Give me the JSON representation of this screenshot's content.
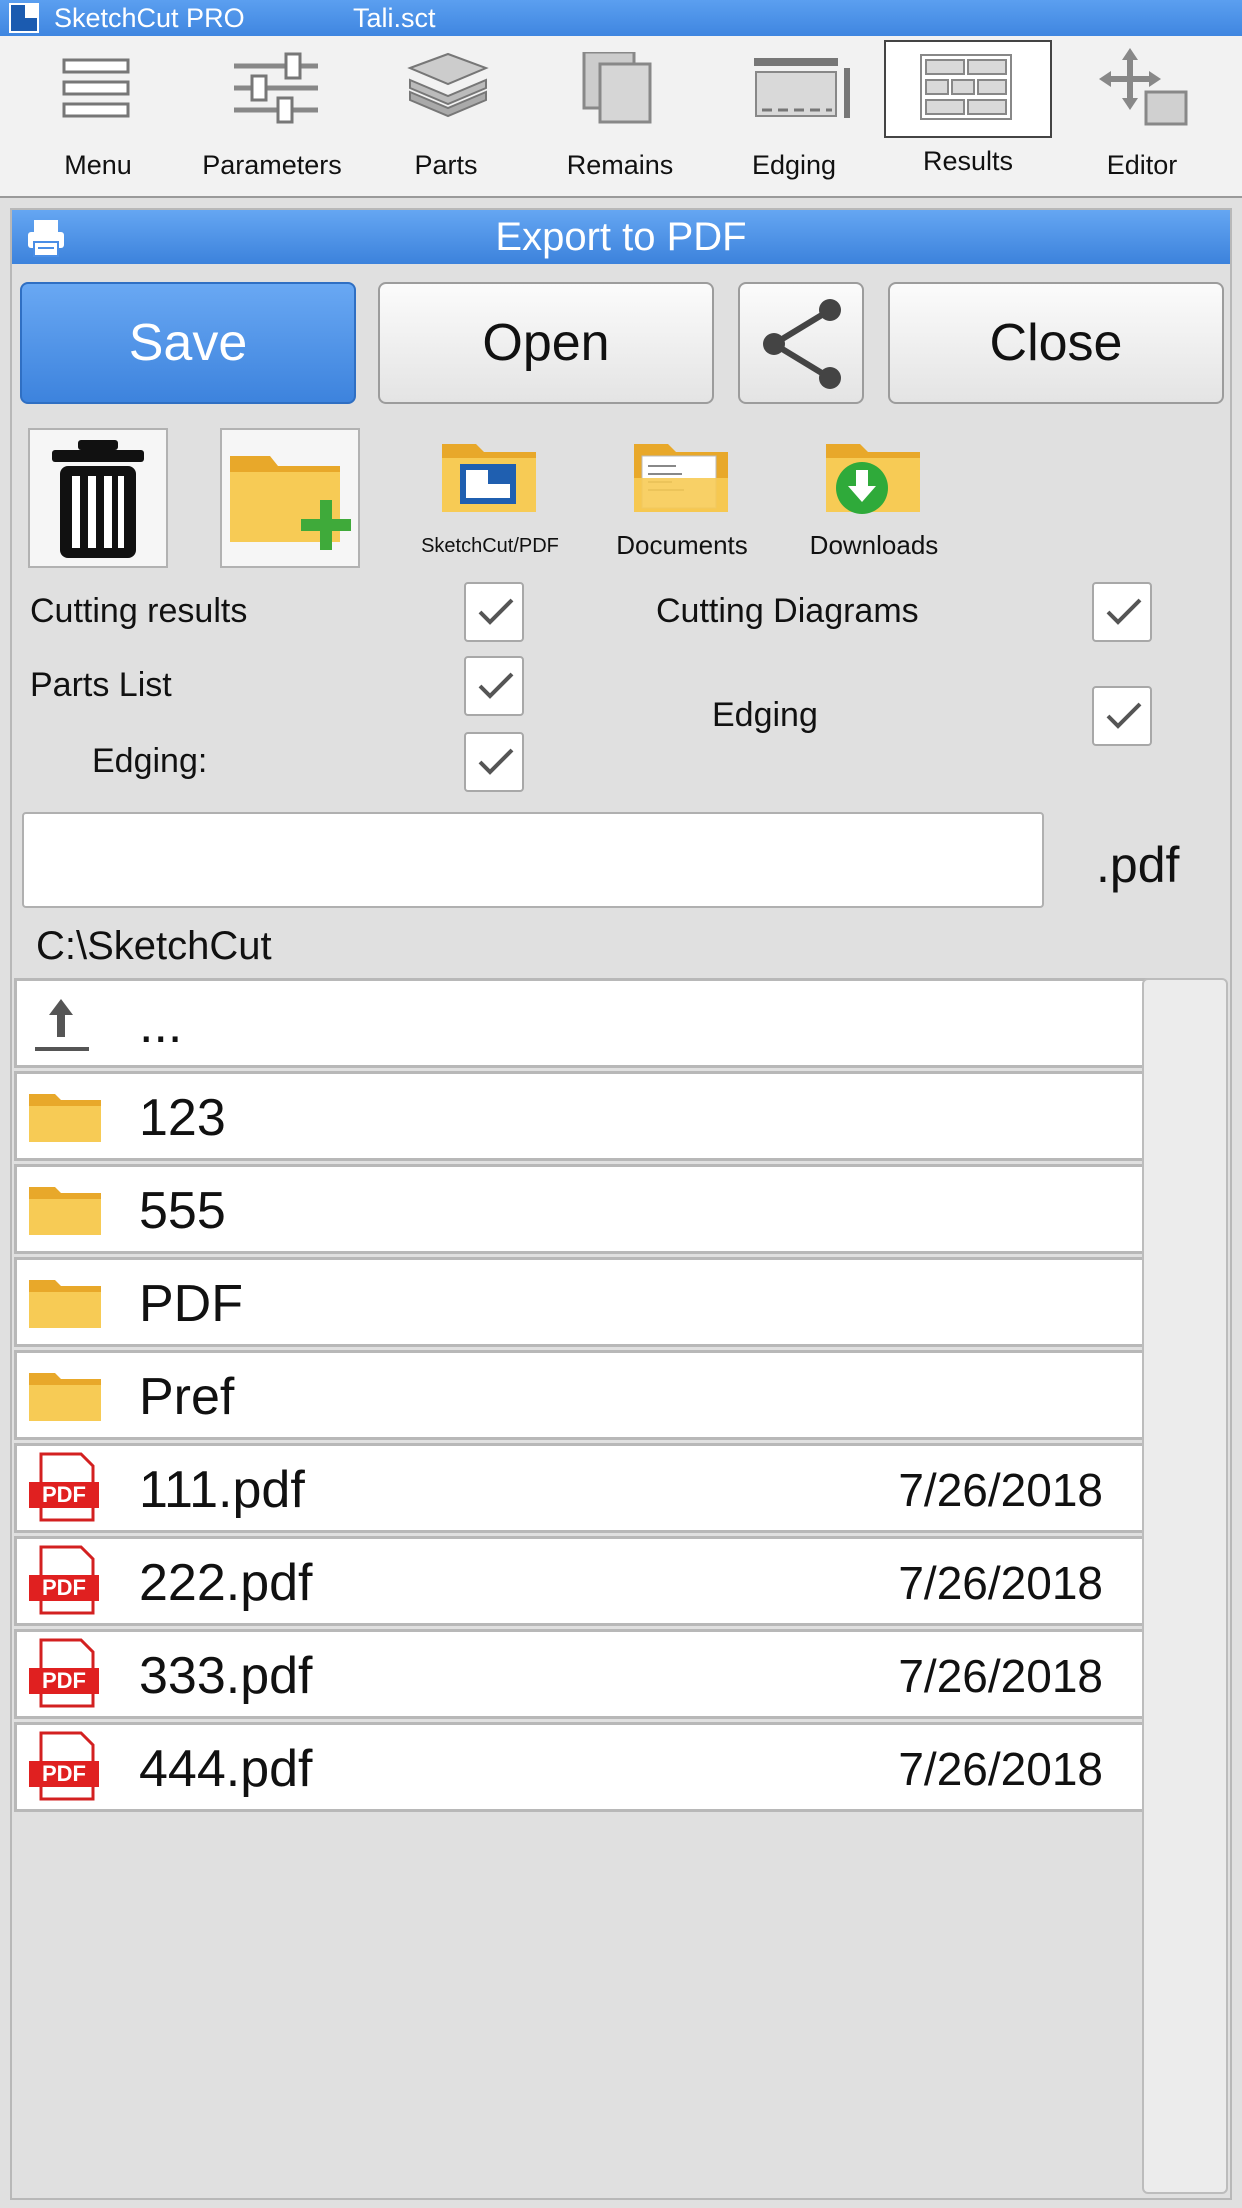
{
  "titlebar": {
    "app_name": "SketchCut PRO",
    "file_name": "Tali.sct"
  },
  "toolbar": {
    "items": [
      {
        "label": "Menu",
        "icon": "menu-icon"
      },
      {
        "label": "Parameters",
        "icon": "sliders-icon"
      },
      {
        "label": "Parts",
        "icon": "layers-icon"
      },
      {
        "label": "Remains",
        "icon": "remains-icon"
      },
      {
        "label": "Edging",
        "icon": "edging-icon"
      },
      {
        "label": "Results",
        "icon": "results-icon",
        "active": true
      },
      {
        "label": "Editor",
        "icon": "move-icon"
      }
    ]
  },
  "dialog": {
    "title": "Export to PDF",
    "buttons": {
      "save": "Save",
      "open": "Open",
      "close": "Close"
    },
    "folders": {
      "sketchcut": "SketchCut/PDF",
      "documents": "Documents",
      "downloads": "Downloads"
    },
    "options": {
      "cutting_results": {
        "label": "Cutting results",
        "checked": true
      },
      "cutting_diagrams": {
        "label": "Cutting Diagrams",
        "checked": true
      },
      "parts_list": {
        "label": "Parts List",
        "checked": true
      },
      "edging_right": {
        "label": "Edging",
        "checked": true
      },
      "edging_sub": {
        "label": "Edging:",
        "checked": true
      }
    },
    "filename": {
      "value": "",
      "extension": ".pdf"
    },
    "current_path": "C:\\SketchCut",
    "files": [
      {
        "name": "...",
        "type": "up",
        "date": ""
      },
      {
        "name": "123",
        "type": "folder",
        "date": ""
      },
      {
        "name": "555",
        "type": "folder",
        "date": ""
      },
      {
        "name": "PDF",
        "type": "folder",
        "date": ""
      },
      {
        "name": "Pref",
        "type": "folder",
        "date": ""
      },
      {
        "name": "111.pdf",
        "type": "pdf",
        "date": "7/26/2018"
      },
      {
        "name": "222.pdf",
        "type": "pdf",
        "date": "7/26/2018"
      },
      {
        "name": "333.pdf",
        "type": "pdf",
        "date": "7/26/2018"
      },
      {
        "name": "444.pdf",
        "type": "pdf",
        "date": "7/26/2018"
      }
    ]
  }
}
